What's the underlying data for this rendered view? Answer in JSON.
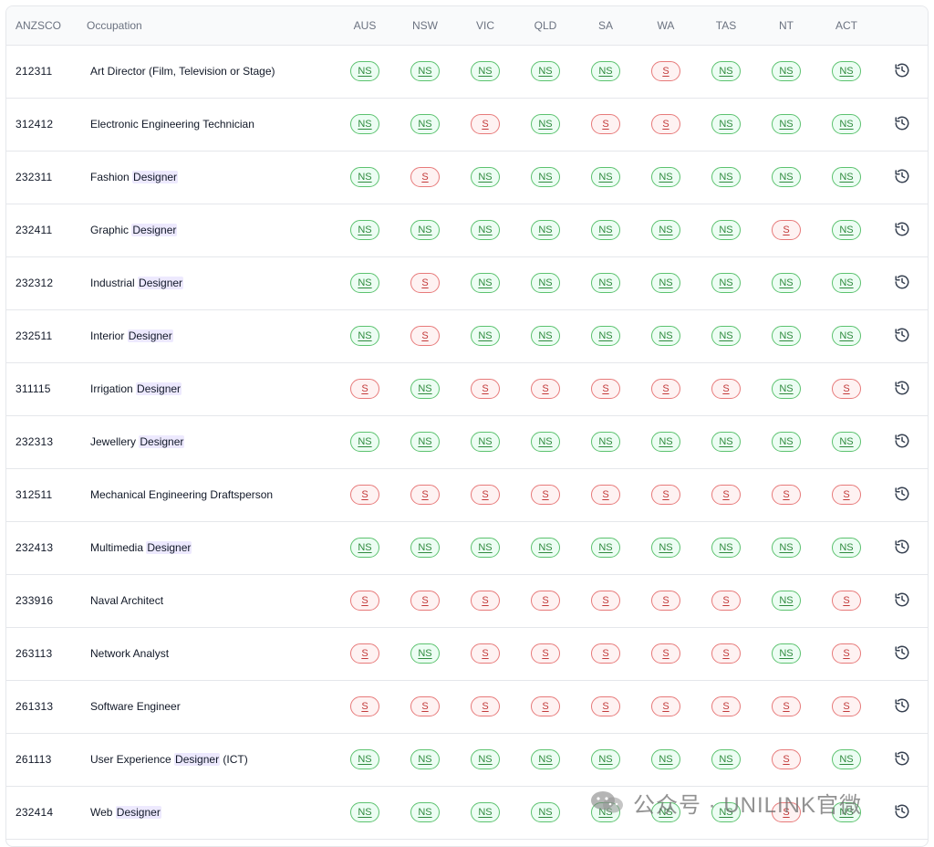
{
  "header": {
    "code": "ANZSCO",
    "occupation": "Occupation",
    "states": [
      "AUS",
      "NSW",
      "VIC",
      "QLD",
      "SA",
      "WA",
      "TAS",
      "NT",
      "ACT"
    ]
  },
  "rows": [
    {
      "code": "212311",
      "occ_pre": "Art Director (Film, Television or Stage)",
      "occ_hl": "",
      "occ_post": "",
      "statuses": [
        "NS",
        "NS",
        "NS",
        "NS",
        "NS",
        "S",
        "NS",
        "NS",
        "NS"
      ]
    },
    {
      "code": "312412",
      "occ_pre": "Electronic Engineering Technician",
      "occ_hl": "",
      "occ_post": "",
      "statuses": [
        "NS",
        "NS",
        "S",
        "NS",
        "S",
        "S",
        "NS",
        "NS",
        "NS"
      ]
    },
    {
      "code": "232311",
      "occ_pre": "Fashion ",
      "occ_hl": "Designer",
      "occ_post": "",
      "statuses": [
        "NS",
        "S",
        "NS",
        "NS",
        "NS",
        "NS",
        "NS",
        "NS",
        "NS"
      ]
    },
    {
      "code": "232411",
      "occ_pre": "Graphic ",
      "occ_hl": "Designer",
      "occ_post": "",
      "statuses": [
        "NS",
        "NS",
        "NS",
        "NS",
        "NS",
        "NS",
        "NS",
        "S",
        "NS"
      ]
    },
    {
      "code": "232312",
      "occ_pre": "Industrial ",
      "occ_hl": "Designer",
      "occ_post": "",
      "statuses": [
        "NS",
        "S",
        "NS",
        "NS",
        "NS",
        "NS",
        "NS",
        "NS",
        "NS"
      ]
    },
    {
      "code": "232511",
      "occ_pre": "Interior ",
      "occ_hl": "Designer",
      "occ_post": "",
      "statuses": [
        "NS",
        "S",
        "NS",
        "NS",
        "NS",
        "NS",
        "NS",
        "NS",
        "NS"
      ]
    },
    {
      "code": "311115",
      "occ_pre": "Irrigation ",
      "occ_hl": "Designer",
      "occ_post": "",
      "statuses": [
        "S",
        "NS",
        "S",
        "S",
        "S",
        "S",
        "S",
        "NS",
        "S"
      ]
    },
    {
      "code": "232313",
      "occ_pre": "Jewellery ",
      "occ_hl": "Designer",
      "occ_post": "",
      "statuses": [
        "NS",
        "NS",
        "NS",
        "NS",
        "NS",
        "NS",
        "NS",
        "NS",
        "NS"
      ]
    },
    {
      "code": "312511",
      "occ_pre": "Mechanical Engineering Draftsperson",
      "occ_hl": "",
      "occ_post": "",
      "statuses": [
        "S",
        "S",
        "S",
        "S",
        "S",
        "S",
        "S",
        "S",
        "S"
      ]
    },
    {
      "code": "232413",
      "occ_pre": "Multimedia ",
      "occ_hl": "Designer",
      "occ_post": "",
      "statuses": [
        "NS",
        "NS",
        "NS",
        "NS",
        "NS",
        "NS",
        "NS",
        "NS",
        "NS"
      ]
    },
    {
      "code": "233916",
      "occ_pre": "Naval Architect",
      "occ_hl": "",
      "occ_post": "",
      "statuses": [
        "S",
        "S",
        "S",
        "S",
        "S",
        "S",
        "S",
        "NS",
        "S"
      ]
    },
    {
      "code": "263113",
      "occ_pre": "Network Analyst",
      "occ_hl": "",
      "occ_post": "",
      "statuses": [
        "S",
        "NS",
        "S",
        "S",
        "S",
        "S",
        "S",
        "NS",
        "S"
      ]
    },
    {
      "code": "261313",
      "occ_pre": "Software Engineer",
      "occ_hl": "",
      "occ_post": "",
      "statuses": [
        "S",
        "S",
        "S",
        "S",
        "S",
        "S",
        "S",
        "S",
        "S"
      ]
    },
    {
      "code": "261113",
      "occ_pre": "User Experience ",
      "occ_hl": "Designer",
      "occ_post": " (ICT)",
      "statuses": [
        "NS",
        "NS",
        "NS",
        "NS",
        "NS",
        "NS",
        "NS",
        "S",
        "NS"
      ]
    },
    {
      "code": "232414",
      "occ_pre": "Web ",
      "occ_hl": "Designer",
      "occ_post": "",
      "statuses": [
        "NS",
        "NS",
        "NS",
        "NS",
        "NS",
        "NS",
        "NS",
        "S",
        "NS"
      ]
    }
  ],
  "history_icon": "history-icon",
  "watermark": {
    "text": "公众号 · UNILINK官微",
    "icon": "wechat-logo-icon"
  },
  "colors": {
    "ns_border": "#5cc26f",
    "ns_bg": "#ecfdf3",
    "s_border": "#e77a7a",
    "s_bg": "#fef2f2",
    "highlight": "#ede9fe"
  }
}
